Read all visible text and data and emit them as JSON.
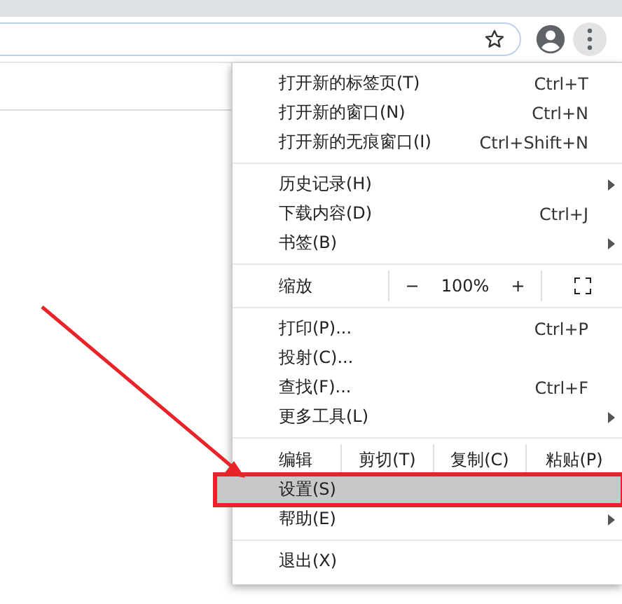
{
  "menu": {
    "sections": [
      {
        "items": [
          {
            "kind": "item",
            "label": "打开新的标签页(T)",
            "shortcut": "Ctrl+T",
            "submenu": false,
            "selected": false
          },
          {
            "kind": "item",
            "label": "打开新的窗口(N)",
            "shortcut": "Ctrl+N",
            "submenu": false,
            "selected": false
          },
          {
            "kind": "item",
            "label": "打开新的无痕窗口(I)",
            "shortcut": "Ctrl+Shift+N",
            "submenu": false,
            "selected": false
          }
        ]
      },
      {
        "items": [
          {
            "kind": "item",
            "label": "历史记录(H)",
            "submenu": true,
            "selected": false
          },
          {
            "kind": "item",
            "label": "下载内容(D)",
            "shortcut": "Ctrl+J",
            "submenu": false,
            "selected": false
          },
          {
            "kind": "item",
            "label": "书签(B)",
            "submenu": true,
            "selected": false
          }
        ]
      },
      {
        "items": [
          {
            "kind": "zoom",
            "label": "缩放",
            "minus": "−",
            "value": "100%",
            "plus": "+"
          }
        ]
      },
      {
        "items": [
          {
            "kind": "item",
            "label": "打印(P)...",
            "shortcut": "Ctrl+P",
            "submenu": false,
            "selected": false
          },
          {
            "kind": "item",
            "label": "投射(C)...",
            "submenu": false,
            "selected": false
          },
          {
            "kind": "item",
            "label": "查找(F)...",
            "shortcut": "Ctrl+F",
            "submenu": false,
            "selected": false
          },
          {
            "kind": "item",
            "label": "更多工具(L)",
            "submenu": true,
            "selected": false
          }
        ]
      },
      {
        "items": [
          {
            "kind": "edit",
            "label": "编辑",
            "actions": [
              "剪切(T)",
              "复制(C)",
              "粘贴(P)"
            ]
          },
          {
            "kind": "item",
            "label": "设置(S)",
            "submenu": false,
            "selected": true,
            "highlighted": true
          },
          {
            "kind": "item",
            "label": "帮助(E)",
            "submenu": true,
            "selected": false
          }
        ]
      },
      {
        "items": [
          {
            "kind": "item",
            "label": "退出(X)",
            "submenu": false,
            "selected": false
          }
        ]
      }
    ]
  }
}
